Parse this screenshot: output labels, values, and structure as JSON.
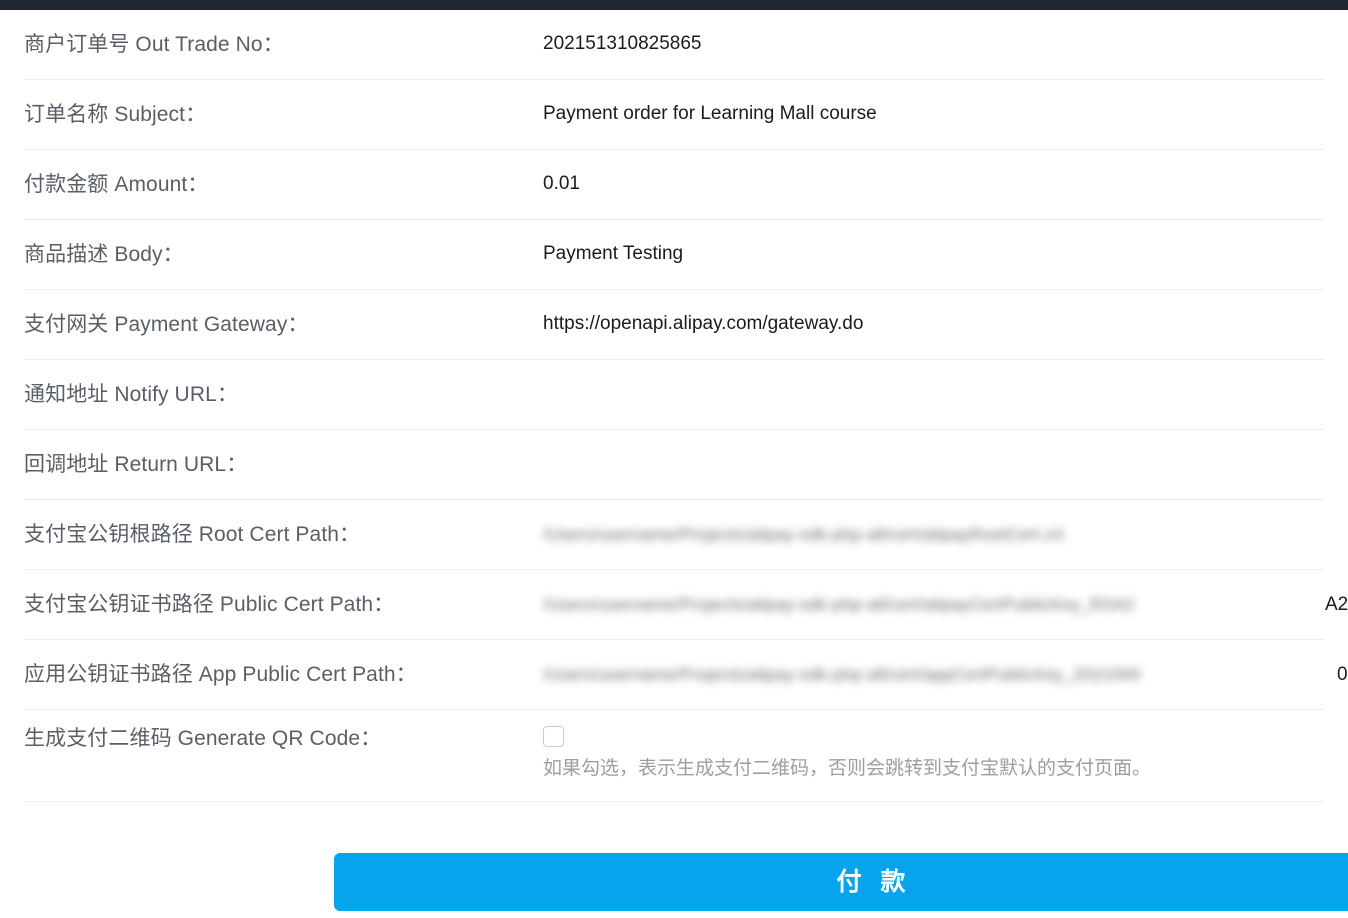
{
  "page": {
    "title_bar_color": "#212730",
    "accent_color": "#05a4ec"
  },
  "form": {
    "rows": [
      {
        "label": "商户订单号 Out Trade No：",
        "value": "202151310825865"
      },
      {
        "label": "订单名称 Subject：",
        "value": "Payment order for Learning Mall course"
      },
      {
        "label": "付款金额 Amount：",
        "value": "0.01"
      },
      {
        "label": "商品描述 Body：",
        "value": "Payment Testing"
      },
      {
        "label": "支付网关 Payment Gateway：",
        "value": "https://openapi.alipay.com/gateway.do"
      },
      {
        "label": "通知地址 Notify URL：",
        "value": ""
      },
      {
        "label": "回调地址 Return URL：",
        "value": ""
      },
      {
        "label": "支付宝公钥根路径 Root Cert Path：",
        "value": ""
      },
      {
        "label": "支付宝公钥证书路径 Public Cert Path：",
        "value": ""
      },
      {
        "label": "应用公钥证书路径 App Public Cert Path：",
        "value": ""
      },
      {
        "label": "生成支付二维码 Generate QR Code：",
        "value": ""
      }
    ],
    "redacted": {
      "root_cert_path_blur": "/Users/username/Projects/alipay-sdk-php-all/cert/alipayRootCert.crt",
      "public_cert_path_blur": "/Users/username/Projects/alipay-sdk-php-all/cert/alipayCertPublicKey_RSA2",
      "public_cert_path_tail": "A2",
      "app_public_cert_path_blur": "/Users/username/Projects/alipay-sdk-php-all/cert/appCertPublicKey_2021000",
      "app_public_cert_path_tail": "0"
    },
    "qr_code": {
      "checked": false,
      "hint": "如果勾选，表示生成支付二维码，否则会跳转到支付宝默认的支付页面。"
    }
  },
  "footer": {
    "pay_button_label": "付 款"
  }
}
